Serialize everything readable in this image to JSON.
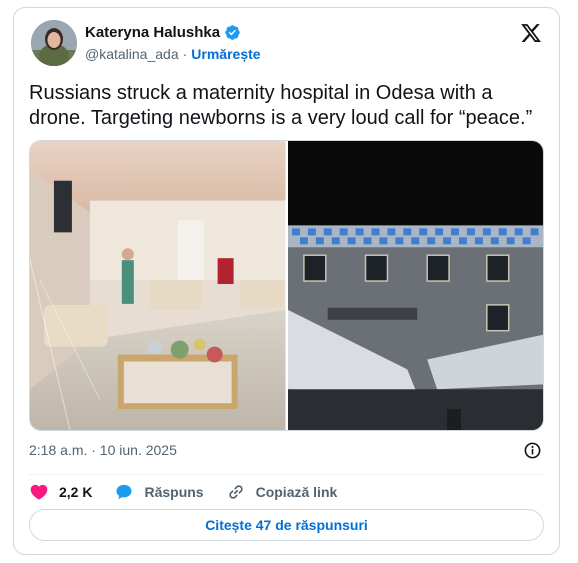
{
  "author": {
    "name": "Kateryna Halushka",
    "handle": "@katalina_ada",
    "separator": "·",
    "follow_label": "Urmărește"
  },
  "tweet": {
    "text": "Russians struck a maternity hospital in Odesa with a drone. Targeting newborns is a very loud call for “peace.”",
    "timestamp": "2:18 a.m. · 10 iun. 2025"
  },
  "actions": {
    "likes_count": "2,2 K",
    "reply_label": "Răspuns",
    "copy_link_label": "Copiază link"
  },
  "replies_button": "Citește 47 de răspunsuri",
  "colors": {
    "link_blue": "#006fd6",
    "verified_blue": "#1d9bf0",
    "like_pink": "#f91880",
    "text": "#0f1419",
    "secondary": "#536471"
  },
  "icons": [
    "verified-icon",
    "x-logo-icon",
    "info-icon",
    "heart-icon",
    "reply-icon",
    "link-icon"
  ]
}
